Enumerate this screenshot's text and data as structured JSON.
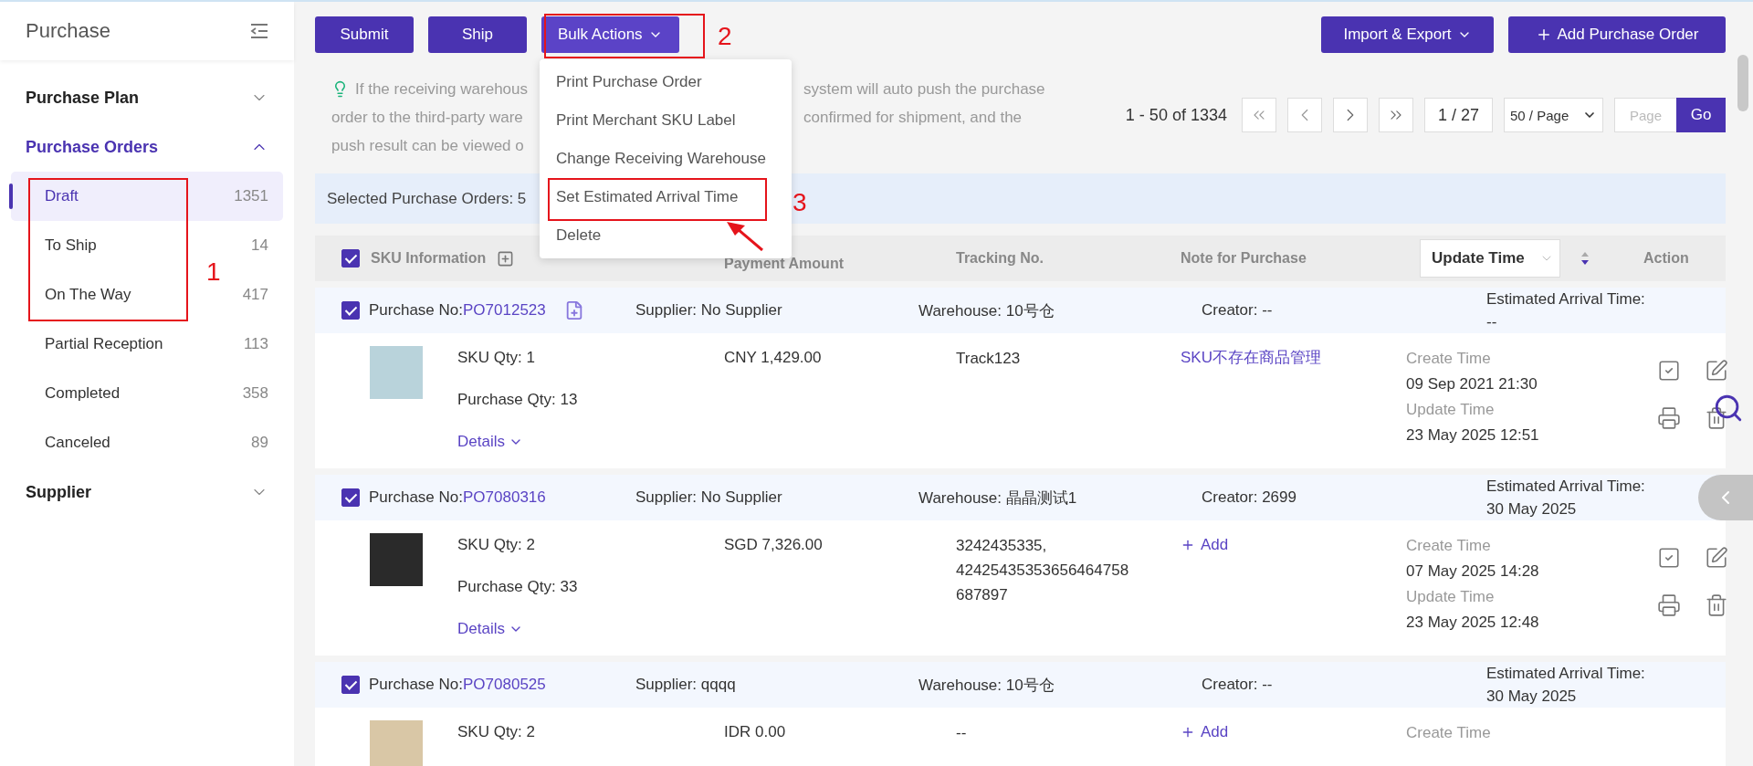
{
  "sidebar": {
    "title": "Purchase",
    "groups": [
      {
        "label": "Purchase Plan",
        "expanded": false,
        "selected": false
      },
      {
        "label": "Purchase Orders",
        "expanded": true,
        "selected": true,
        "items": [
          {
            "label": "Draft",
            "count": "1351",
            "selected": true
          },
          {
            "label": "To Ship",
            "count": "14",
            "selected": false
          },
          {
            "label": "On The Way",
            "count": "417",
            "selected": false
          },
          {
            "label": "Partial Reception",
            "count": "113",
            "selected": false
          },
          {
            "label": "Completed",
            "count": "358",
            "selected": false
          },
          {
            "label": "Canceled",
            "count": "89",
            "selected": false
          }
        ]
      },
      {
        "label": "Supplier",
        "expanded": false,
        "selected": false
      }
    ]
  },
  "toolbar": {
    "left_buttons": [
      {
        "label": "Submit",
        "kind": "plain"
      },
      {
        "label": "Ship",
        "kind": "plain"
      },
      {
        "label": "Bulk Actions",
        "kind": "dropdown",
        "open": true
      }
    ],
    "right_buttons": [
      {
        "label": "Import & Export",
        "kind": "dropdown"
      },
      {
        "label": "Add Purchase Order",
        "kind": "add"
      }
    ]
  },
  "bulk_menu": {
    "items": [
      "Print Purchase Order",
      "Print Merchant SKU Label",
      "Change Receiving Warehouse",
      "Set Estimated Arrival Time",
      "Delete"
    ]
  },
  "hint": {
    "lines": [
      {
        "left": "If the receiving warehous",
        "right": "system will auto push the purchase"
      },
      {
        "left": "order to the third-party ware",
        "right": "confirmed for shipment, and the"
      },
      {
        "left": "push result can be viewed o"
      }
    ]
  },
  "pagination": {
    "range": "1 - 50 of 1334",
    "page": "1 / 27",
    "page_size": "50 / Page",
    "page_placeholder": "Page",
    "go": "Go"
  },
  "selection_bar": "Selected Purchase Orders: 5",
  "table": {
    "all_checked": true,
    "columns": [
      {
        "label": "SKU Information",
        "kind": "expand"
      },
      {
        "label": "Payment Amount",
        "kind": "text"
      },
      {
        "label": "Tracking No.",
        "kind": "text"
      },
      {
        "label": "Note for Purchase",
        "kind": "text"
      },
      {
        "label": "Update Time",
        "kind": "sort"
      },
      {
        "label": "Action",
        "kind": "text"
      }
    ],
    "orders": [
      {
        "checked": true,
        "po_label": "Purchase No:",
        "po": "PO7012523",
        "note_icon": true,
        "supplier": "Supplier: No Supplier",
        "warehouse": "Warehouse: 10号仓",
        "creator": "Creator: --",
        "eta_label": "Estimated Arrival Time:",
        "eta": "--",
        "sku_qty": "SKU Qty: 1",
        "purchase_qty": "Purchase Qty: 13",
        "details": "Details",
        "amount": "CNY 1,429.00",
        "tracking": [
          "Track123"
        ],
        "note": {
          "kind": "link",
          "text": "SKU不存在商品管理"
        },
        "create_label": "Create Time",
        "create_time": "09 Sep 2021 21:30",
        "update_label": "Update Time",
        "update_time": "23 May 2025 12:51",
        "actions": true
      },
      {
        "checked": true,
        "po_label": "Purchase No:",
        "po": "PO7080316",
        "note_icon": false,
        "supplier": "Supplier: No Supplier",
        "warehouse": "Warehouse: 晶晶测试1",
        "creator": "Creator: 2699",
        "eta_label": "Estimated Arrival Time:",
        "eta": "30 May 2025",
        "sku_qty": "SKU Qty: 2",
        "purchase_qty": "Purchase Qty: 33",
        "details": "Details",
        "amount": "SGD 7,326.00",
        "tracking": [
          "3242435335,",
          "42425435353656464758",
          "687897"
        ],
        "note": {
          "kind": "add",
          "text": "Add"
        },
        "create_label": "Create Time",
        "create_time": "07 May 2025 14:28",
        "update_label": "Update Time",
        "update_time": "23 May 2025 12:48",
        "actions": true
      },
      {
        "checked": true,
        "po_label": "Purchase No:",
        "po": "PO7080525",
        "note_icon": false,
        "supplier": "Supplier: qqqq",
        "warehouse": "Warehouse: 10号仓",
        "creator": "Creator: --",
        "eta_label": "Estimated Arrival Time:",
        "eta": "30 May 2025",
        "sku_qty": "SKU Qty: 2",
        "amount": "IDR 0.00",
        "tracking": [
          "--"
        ],
        "note": {
          "kind": "add",
          "text": "Add"
        },
        "create_label": "Create Time",
        "actions": false
      }
    ]
  },
  "annotations": [
    {
      "number": "1",
      "arrow": false
    },
    {
      "number": "2",
      "arrow": false
    },
    {
      "number": "3",
      "arrow": true
    }
  ]
}
